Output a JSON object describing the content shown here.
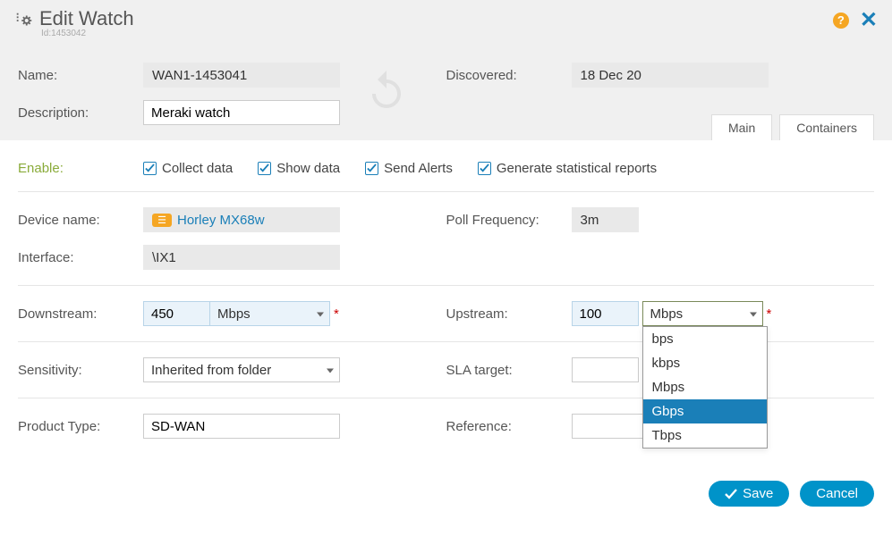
{
  "header": {
    "title": "Edit Watch",
    "id_label": "Id:1453042"
  },
  "top": {
    "name_label": "Name:",
    "name_value": "WAN1-1453041",
    "desc_label": "Description:",
    "desc_value": "Meraki watch",
    "discovered_label": "Discovered:",
    "discovered_value": "18 Dec 20"
  },
  "tabs": {
    "main": "Main",
    "containers": "Containers"
  },
  "enable": {
    "label": "Enable:",
    "collect": "Collect data",
    "show": "Show data",
    "send": "Send Alerts",
    "stats": "Generate statistical reports"
  },
  "device": {
    "name_label": "Device name:",
    "name_value": "Horley MX68w",
    "poll_label": "Poll Frequency:",
    "poll_value": "3m",
    "iface_label": "Interface:",
    "iface_value": "\\IX1"
  },
  "bw": {
    "down_label": "Downstream:",
    "down_value": "450",
    "down_unit": "Mbps",
    "up_label": "Upstream:",
    "up_value": "100",
    "up_unit": "Mbps",
    "unit_options": [
      "bps",
      "kbps",
      "Mbps",
      "Gbps",
      "Tbps"
    ],
    "unit_highlighted": "Gbps"
  },
  "sens": {
    "label": "Sensitivity:",
    "value": "Inherited from folder",
    "sla_label": "SLA target:",
    "sla_value": ""
  },
  "prod": {
    "label": "Product Type:",
    "value": "SD-WAN",
    "ref_label": "Reference:",
    "ref_value": ""
  },
  "footer": {
    "save": "Save",
    "cancel": "Cancel"
  }
}
